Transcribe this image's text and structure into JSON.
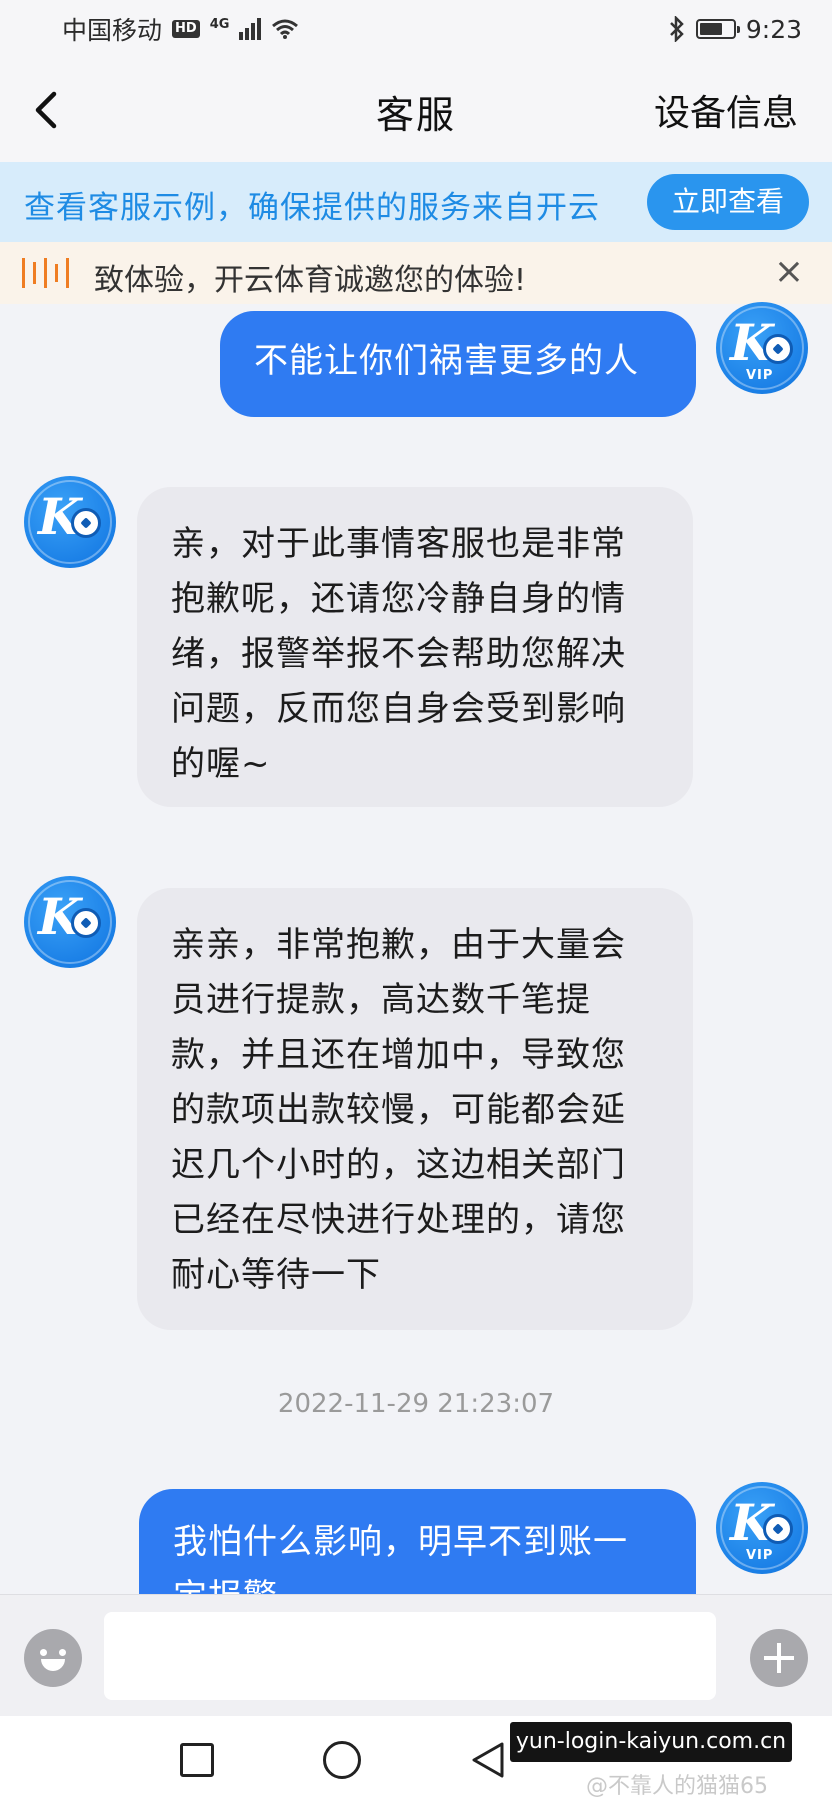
{
  "status_bar": {
    "carrier": "中国移动",
    "hd_badge": "HD",
    "network": "4G",
    "time": "9:23"
  },
  "nav": {
    "back_label": "‹",
    "title": "客服",
    "right_label": "设备信息"
  },
  "notice": {
    "text": "查看客服示例，确保提供的服务来自开云",
    "button_label": "立即查看"
  },
  "marquee": {
    "text": "致体验，开云体育诚邀您的体验!",
    "close_label": "×"
  },
  "messages": [
    {
      "sender": "user",
      "text": "不能让你们祸害更多的人"
    },
    {
      "sender": "agent",
      "text": "亲，对于此事情客服也是非常抱歉呢，还请您冷静自身的情绪，报警举报不会帮助您解决问题，反而您自身会受到影响的喔~"
    },
    {
      "sender": "agent",
      "text": "亲亲，非常抱歉，由于大量会员进行提款，高达数千笔提款，并且还在增加中，导致您的款项出款较慢，可能都会延迟几个小时的，这边相关部门已经在尽快进行处理的，请您耐心等待一下"
    },
    {
      "sender": "user",
      "text": "我怕什么影响，明早不到账一定报警"
    }
  ],
  "timestamp": "2022-11-29 21:23:07",
  "avatar": {
    "letter": "K",
    "vip_label": "VIP"
  },
  "input": {
    "placeholder": ""
  },
  "watermarks": {
    "domain": "yun-login-kaiyun.com.cn",
    "author": "@不靠人的猫猫65"
  },
  "colors": {
    "accent": "#2f7bf2",
    "notice_bg": "#d7ecfb",
    "notice_text": "#1e8be4",
    "marquee_bg": "#faf3ea",
    "incoming_bubble": "#e9e9ee"
  },
  "icons": [
    "back-icon",
    "bluetooth-icon",
    "wifi-icon",
    "signal-icon",
    "battery-icon",
    "speaker-icon",
    "close-icon",
    "emoji-icon",
    "plus-icon",
    "home-icon",
    "back-triangle-icon",
    "recents-icon"
  ]
}
